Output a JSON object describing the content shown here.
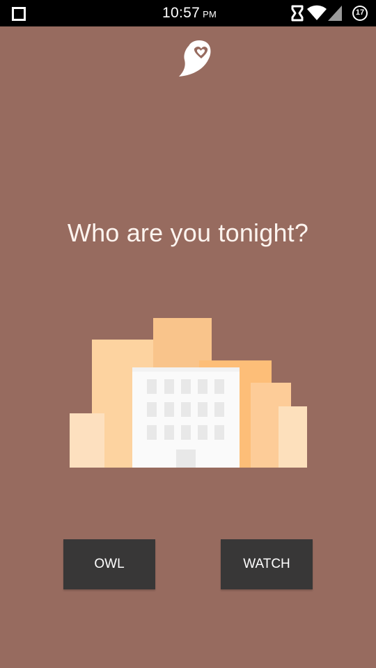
{
  "status_bar": {
    "time": "10:57",
    "ampm": "PM",
    "notification_count": "17",
    "icons": [
      "square-icon",
      "vibrate-icon",
      "wifi-icon",
      "signal-icon",
      "notification-badge-icon"
    ]
  },
  "app": {
    "logo": "owl-heart-logo-icon"
  },
  "main": {
    "headline": "Who are you tonight?",
    "illustration": "city-buildings-illustration"
  },
  "buttons": {
    "owl_label": "OWL",
    "watch_label": "WATCH"
  },
  "colors": {
    "background": "#976b5f",
    "status_bar": "#000000",
    "button": "#383737",
    "text": "#fdf4ef"
  }
}
